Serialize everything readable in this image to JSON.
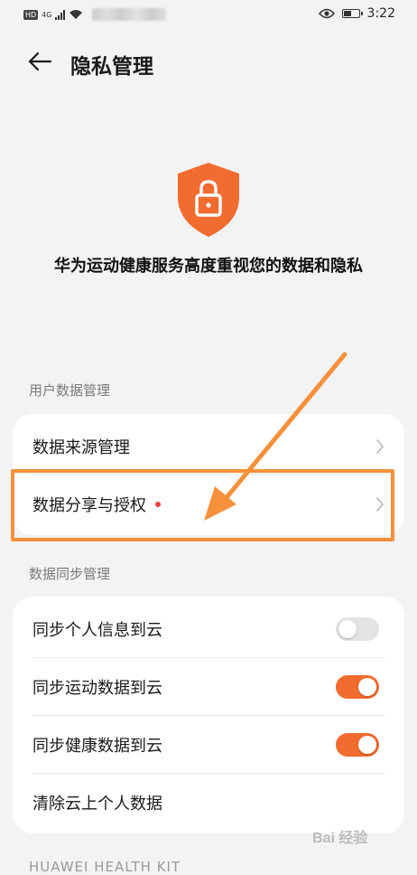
{
  "status_bar": {
    "hd": "HD",
    "network": "4G",
    "time": "3:22"
  },
  "header": {
    "title": "隐私管理"
  },
  "hero": {
    "statement": "华为运动健康服务高度重视您的数据和隐私"
  },
  "sections": [
    {
      "title": "用户数据管理",
      "items": [
        {
          "label": "数据来源管理",
          "has_dot": false
        },
        {
          "label": "数据分享与授权",
          "has_dot": true
        }
      ]
    },
    {
      "title": "数据同步管理",
      "items": [
        {
          "label": "同步个人信息到云",
          "toggle": "off"
        },
        {
          "label": "同步运动数据到云",
          "toggle": "on"
        },
        {
          "label": "同步健康数据到云",
          "toggle": "on"
        },
        {
          "label": "清除云上个人数据"
        }
      ]
    }
  ],
  "footer": {
    "partial_text": "HUAWEI HEALTH KIT"
  },
  "watermark": {
    "text": "Bai 经验"
  },
  "colors": {
    "accent": "#f26b2f",
    "annotation": "#f7903a",
    "red_dot": "#e64340",
    "background": "#f1f3f5"
  }
}
